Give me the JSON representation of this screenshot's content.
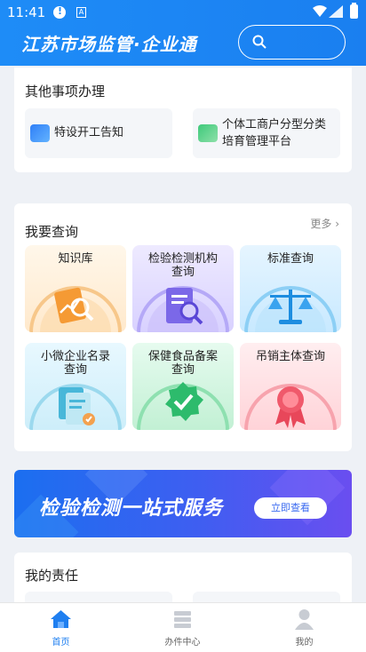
{
  "status_bar": {
    "time": "11:41",
    "a_badge": "A"
  },
  "header": {
    "title": "江苏市场监管·企业通",
    "search_placeholder": ""
  },
  "other_services": {
    "title": "其他事项办理",
    "items": [
      {
        "label": "特设开工告知",
        "icon": "blue-doc-icon"
      },
      {
        "label": "个体工商户分型分类培育管理平台",
        "line1": "个体工商户分型分类",
        "line2": "培育管理平台",
        "icon": "green-doc-icon"
      }
    ]
  },
  "query": {
    "title": "我要查询",
    "more": "更多",
    "tiles": [
      {
        "line1": "知识库",
        "line2": "",
        "icon": "knowledge-icon"
      },
      {
        "line1": "检验检测机构",
        "line2": "查询",
        "icon": "inspection-icon"
      },
      {
        "line1": "标准查询",
        "line2": "",
        "icon": "scale-icon"
      },
      {
        "line1": "小微企业名录",
        "line2": "查询",
        "icon": "directory-icon"
      },
      {
        "line1": "保健食品备案",
        "line2": "查询",
        "icon": "check-badge-icon"
      },
      {
        "line1": "吊销主体查询",
        "line2": "",
        "icon": "ribbon-icon"
      }
    ]
  },
  "banner": {
    "title": "检验检测一站式服务",
    "button": "立即查看"
  },
  "responsibility": {
    "title": "我的责任"
  },
  "bottom_nav": [
    {
      "label": "首页",
      "icon": "home-icon",
      "active": true
    },
    {
      "label": "办件中心",
      "icon": "files-icon",
      "active": false
    },
    {
      "label": "我的",
      "icon": "person-icon",
      "active": false
    }
  ],
  "colors": {
    "primary": "#1f7ff0"
  }
}
